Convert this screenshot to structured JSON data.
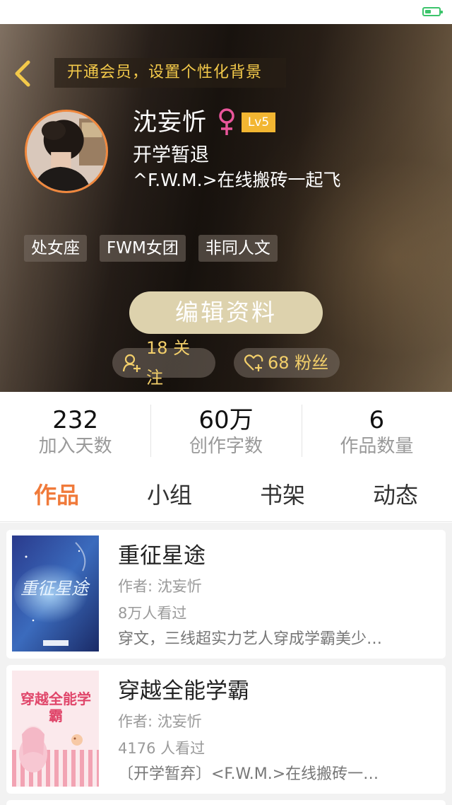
{
  "vip_banner": "开通会员，设置个性化背景",
  "profile": {
    "nickname": "沈妄忻",
    "level": "Lv5",
    "signature_line1": "开学暂退",
    "signature_line2": "^F.W.M.>在线搬砖一起飞"
  },
  "tags": [
    "处女座",
    "FWM女团",
    "非同人文"
  ],
  "edit_button": "编辑资料",
  "follow_label": "18 关注",
  "fans_label": "68 粉丝",
  "stats": [
    {
      "value": "232",
      "label": "加入天数"
    },
    {
      "value": "60万",
      "label": "创作字数"
    },
    {
      "value": "6",
      "label": "作品数量"
    }
  ],
  "tabs": [
    {
      "label": "作品",
      "active": true
    },
    {
      "label": "小组",
      "active": false
    },
    {
      "label": "书架",
      "active": false
    },
    {
      "label": "动态",
      "active": false
    }
  ],
  "works": [
    {
      "title": "重征星途",
      "author": "作者: 沈妄忻",
      "reads": "8万人看过",
      "description": "穿文，三线超实力艺人穿成学霸美少…",
      "cover_text": "重征星途"
    },
    {
      "title": "穿越全能学霸",
      "author": "作者: 沈妄忻",
      "reads": "4176 人看过",
      "description": "〔开学暂弃〕<F.W.M.>在线搬砖一…",
      "cover_text": "穿越全能学霸"
    }
  ],
  "colors": {
    "accent": "#f07a3a",
    "vip_text": "#f3c94a",
    "level_badge": "#f2b632",
    "edit_button_bg": "#ddd2ad",
    "pill_text": "#f3cf6a",
    "female_icon": "#e9569b",
    "battery": "#3cc46b"
  }
}
